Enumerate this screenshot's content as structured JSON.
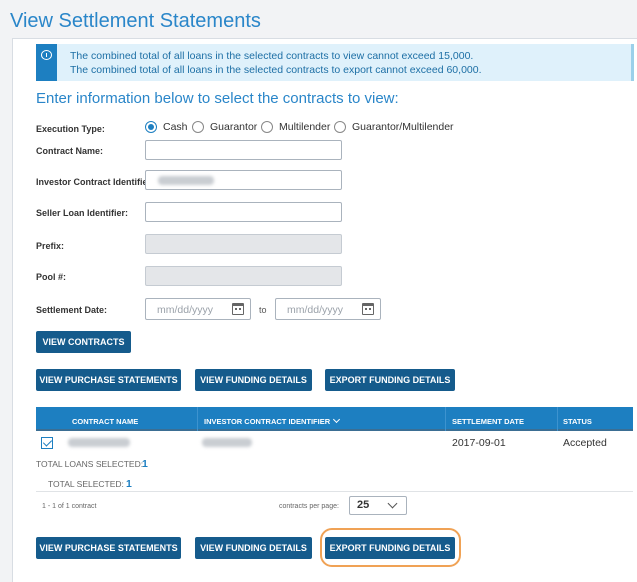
{
  "page": {
    "title": "View Settlement Statements"
  },
  "info": {
    "lines": [
      "The combined total of all loans in the selected contracts to view cannot exceed 15,000.",
      "The combined total of all loans in the selected contracts to export cannot exceed 60,000."
    ],
    "icon": "info-chat-icon"
  },
  "form": {
    "heading": "Enter information below to select the contracts to view:",
    "execution_type": {
      "label": "Execution Type:",
      "options": [
        "Cash",
        "Guarantor",
        "Multilender",
        "Guarantor/Multilender"
      ],
      "selected": "Cash"
    },
    "contract_name": {
      "label": "Contract Name:",
      "value": ""
    },
    "investor_contract_identifier": {
      "label": "Investor Contract Identifier:",
      "value": ""
    },
    "seller_loan_identifier": {
      "label": "Seller Loan Identifier:",
      "value": ""
    },
    "prefix": {
      "label": "Prefix:",
      "value": ""
    },
    "pool": {
      "label": "Pool #:",
      "value": ""
    },
    "settlement_date": {
      "label": "Settlement Date:",
      "from_placeholder": "mm/dd/yyyy",
      "to_label": "to",
      "to_placeholder": "mm/dd/yyyy"
    },
    "view_contracts_label": "VIEW CONTRACTS"
  },
  "actions": {
    "view_purchase_statements": "VIEW PURCHASE STATEMENTS",
    "view_funding_details": "VIEW FUNDING DETAILS",
    "export_funding_details": "EXPORT FUNDING DETAILS"
  },
  "table": {
    "columns": [
      "CONTRACT NAME",
      "INVESTOR CONTRACT IDENTIFIER",
      "SETTLEMENT DATE",
      "STATUS"
    ],
    "rows": [
      {
        "selected": true,
        "contract_name": "",
        "investor_contract_identifier": "",
        "settlement_date": "2017-09-01",
        "status": "Accepted"
      }
    ]
  },
  "totals": {
    "loans_label": "TOTAL LOANS SELECTED:",
    "loans_value": "1",
    "selected_label": "TOTAL SELECTED:",
    "selected_value": "1"
  },
  "pagination": {
    "summary": "1 - 1 of 1 contract",
    "per_page_label": "contracts per page:",
    "per_page_value": "25"
  },
  "colors": {
    "primary": "#1d7fc1",
    "button": "#155b8c",
    "heading": "#2a86c9",
    "info_bg": "#dff1fb",
    "highlight": "#f0a255"
  }
}
